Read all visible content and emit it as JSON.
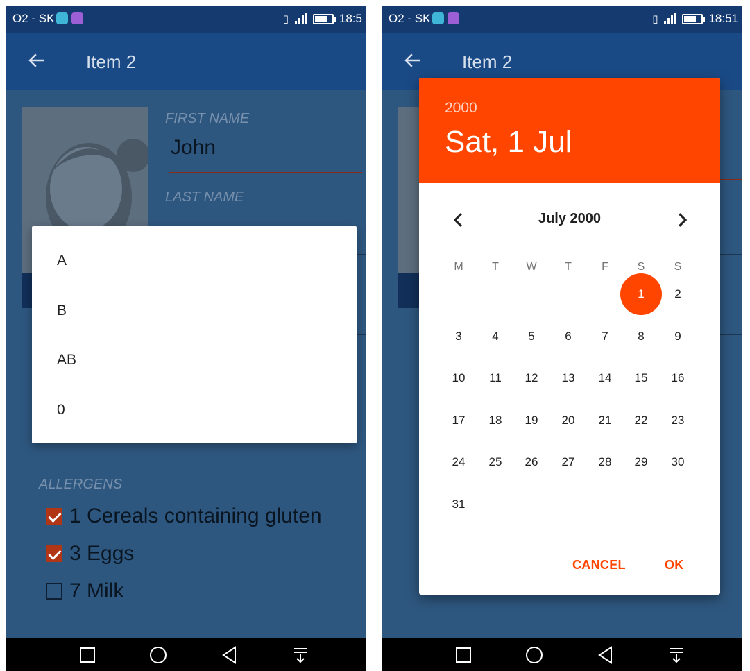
{
  "status_bar": {
    "carrier": "O2 - SK",
    "time_left": "18:5",
    "time_right": "18:51"
  },
  "app_bar": {
    "title": "Item 2"
  },
  "form": {
    "first_name_label": "FIRST NAME",
    "first_name_value": "John",
    "last_name_label": "LAST NAME",
    "allergens_label": "ALLERGENS",
    "allergens": [
      {
        "label": "1 Cereals containing gluten",
        "checked": true
      },
      {
        "label": "3 Eggs",
        "checked": true
      },
      {
        "label": "7 Milk",
        "checked": false
      }
    ]
  },
  "blood_type_popup": {
    "options": [
      "A",
      "B",
      "AB",
      "0"
    ]
  },
  "date_picker": {
    "year": "2000",
    "selected_date": "Sat, 1 Jul",
    "month_title": "July 2000",
    "weekdays": [
      "M",
      "T",
      "W",
      "T",
      "F",
      "S",
      "S"
    ],
    "first_weekday_index": 5,
    "days_in_month": 31,
    "selected_day": 1,
    "cancel_label": "CANCEL",
    "ok_label": "OK"
  },
  "colors": {
    "accent": "#ff4500",
    "app_bar": "#1a4a86",
    "status_bar": "#143a70",
    "dim_content": "#2e577f"
  },
  "icons": {
    "back": "arrow-left-icon",
    "prev_month": "chevron-left-icon",
    "next_month": "chevron-right-icon",
    "nav_recents": "square-icon",
    "nav_home": "circle-icon",
    "nav_back": "triangle-back-icon",
    "nav_notifications": "pull-down-icon"
  }
}
